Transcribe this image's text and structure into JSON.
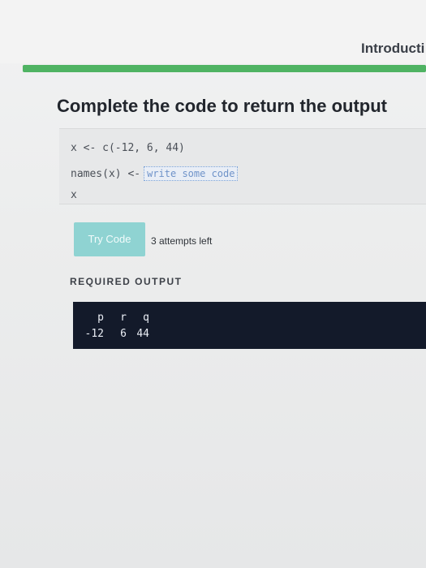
{
  "header": {
    "course_title": "Introducti"
  },
  "progress": {
    "fraction": 1.0,
    "fill_color": "#4fb363"
  },
  "exercise": {
    "title": "Complete the code to return the output",
    "code": {
      "line1": "x <- c(-12, 6, 44)",
      "line2_prefix": "names(x) <-",
      "input_placeholder": "write some code",
      "line3": "x"
    },
    "try_button_label": "Try Code",
    "attempts_text": "3 attempts left",
    "required_output_label": "REQUIRED OUTPUT",
    "output": {
      "names": [
        "p",
        "r",
        "q"
      ],
      "values": [
        "-12",
        "6",
        "44"
      ]
    }
  },
  "colors": {
    "button_bg": "#8fd3d2",
    "output_bg": "#131a2a"
  }
}
